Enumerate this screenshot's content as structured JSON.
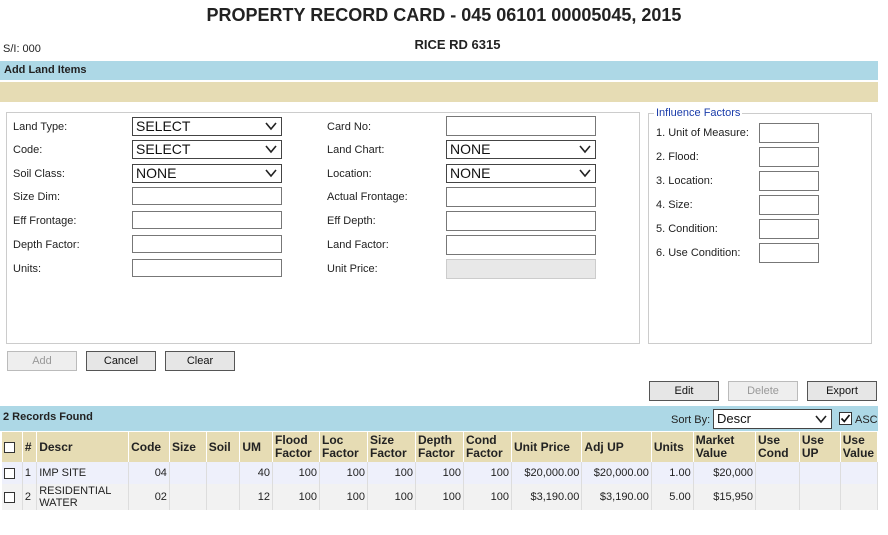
{
  "header": {
    "title": "PROPERTY RECORD CARD - 045 06101 00005045, 2015",
    "subtitle": "RICE RD 6315",
    "si": "S/I: 000"
  },
  "add_land": {
    "heading": "Add Land Items"
  },
  "form": {
    "land_type": {
      "label": "Land Type:",
      "value": "SELECT"
    },
    "code": {
      "label": "Code:",
      "value": "SELECT"
    },
    "soil_class": {
      "label": "Soil Class:",
      "value": "NONE"
    },
    "size_dim": {
      "label": "Size Dim:",
      "value": ""
    },
    "eff_frontage": {
      "label": "Eff Frontage:",
      "value": ""
    },
    "depth_factor": {
      "label": "Depth Factor:",
      "value": ""
    },
    "units": {
      "label": "Units:",
      "value": ""
    },
    "card_no": {
      "label": "Card No:",
      "value": ""
    },
    "land_chart": {
      "label": "Land Chart:",
      "value": "NONE"
    },
    "location": {
      "label": "Location:",
      "value": "NONE"
    },
    "actual_frontage": {
      "label": "Actual Frontage:",
      "value": ""
    },
    "eff_depth": {
      "label": "Eff Depth:",
      "value": ""
    },
    "land_factor": {
      "label": "Land Factor:",
      "value": ""
    },
    "unit_price": {
      "label": "Unit Price:",
      "value": ""
    }
  },
  "influence": {
    "title": "Influence Factors",
    "items": [
      {
        "label": "1. Unit of Measure:",
        "value": ""
      },
      {
        "label": "2. Flood:",
        "value": ""
      },
      {
        "label": "3. Location:",
        "value": ""
      },
      {
        "label": "4. Size:",
        "value": ""
      },
      {
        "label": "5. Condition:",
        "value": ""
      },
      {
        "label": "6. Use Condition:",
        "value": ""
      }
    ]
  },
  "buttons": {
    "add": "Add",
    "cancel": "Cancel",
    "clear": "Clear",
    "edit": "Edit",
    "delete": "Delete",
    "export": "Export"
  },
  "records": {
    "count_text": "2 Records Found",
    "sort_label": "Sort By:",
    "sort_value": "Descr",
    "asc_label": "ASC",
    "asc_checked": true
  },
  "grid": {
    "columns": [
      "#",
      "Descr",
      "Code",
      "Size",
      "Soil",
      "UM",
      "Flood Factor",
      "Loc Factor",
      "Size Factor",
      "Depth Factor",
      "Cond Factor",
      "Unit Price",
      "Adj UP",
      "Units",
      "Market Value",
      "Use Cond",
      "Use UP",
      "Use Value"
    ],
    "rows": [
      {
        "num": "1",
        "descr": "IMP SITE",
        "code": "04",
        "size": "",
        "soil": "",
        "um": "40",
        "flood": "100",
        "loc": "100",
        "sizef": "100",
        "depth": "100",
        "cond": "100",
        "unit_price": "$20,000.00",
        "adj_up": "$20,000.00",
        "units": "1.00",
        "market": "$20,000",
        "use_cond": "",
        "use_up": "",
        "use_value": ""
      },
      {
        "num": "2",
        "descr": "RESIDENTIAL WATER",
        "code": "02",
        "size": "",
        "soil": "",
        "um": "12",
        "flood": "100",
        "loc": "100",
        "sizef": "100",
        "depth": "100",
        "cond": "100",
        "unit_price": "$3,190.00",
        "adj_up": "$3,190.00",
        "units": "5.00",
        "market": "$15,950",
        "use_cond": "",
        "use_up": "",
        "use_value": ""
      }
    ]
  }
}
